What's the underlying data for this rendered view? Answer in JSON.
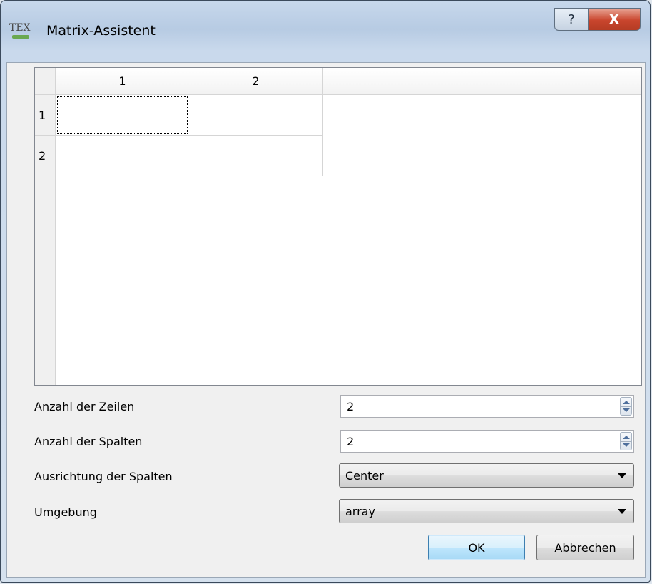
{
  "window": {
    "title": "Matrix-Assistent",
    "app_icon_label": "TEX",
    "help_label": "?",
    "close_label": "X"
  },
  "table": {
    "columns": [
      "1",
      "2"
    ],
    "rows": [
      "1",
      "2"
    ],
    "cells": [
      [
        "",
        ""
      ],
      [
        "",
        ""
      ]
    ]
  },
  "form": {
    "rows_label": "Anzahl der Zeilen",
    "rows_value": "2",
    "cols_label": "Anzahl der Spalten",
    "cols_value": "2",
    "align_label": "Ausrichtung der Spalten",
    "align_value": "Center",
    "env_label": "Umgebung",
    "env_value": "array"
  },
  "buttons": {
    "ok": "OK",
    "cancel": "Abbrechen"
  }
}
